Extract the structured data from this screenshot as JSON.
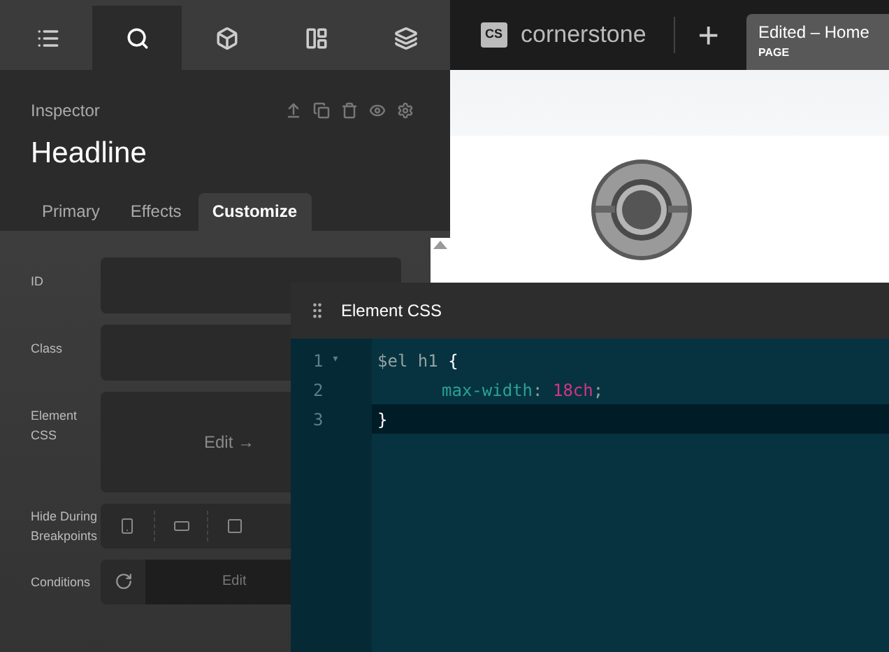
{
  "toolbar": {
    "tabs": [
      {
        "kind": "list",
        "selected": false
      },
      {
        "kind": "search",
        "selected": true
      },
      {
        "kind": "cube",
        "selected": false
      },
      {
        "kind": "layout",
        "selected": false
      },
      {
        "kind": "layers",
        "selected": false
      }
    ]
  },
  "inspector": {
    "label": "Inspector",
    "title": "Headline",
    "actions": [
      {
        "kind": "up"
      },
      {
        "kind": "copy"
      },
      {
        "kind": "trash"
      },
      {
        "kind": "eye"
      },
      {
        "kind": "gear"
      }
    ],
    "tabs": [
      {
        "label": "Primary",
        "selected": false
      },
      {
        "label": "Effects",
        "selected": false
      },
      {
        "label": "Customize",
        "selected": true
      }
    ],
    "fields": [
      {
        "kind": "text",
        "label": "ID"
      },
      {
        "kind": "text",
        "label": "Class"
      },
      {
        "kind": "edit",
        "label": "Element CSS",
        "button": "Edit →"
      },
      {
        "kind": "breakpoints",
        "label": "Hide During Breakpoints",
        "devices": [
          {
            "kind": "phone"
          },
          {
            "kind": "tablet"
          },
          {
            "kind": "square"
          }
        ]
      },
      {
        "kind": "conditions",
        "label": "Conditions",
        "button": "Edit"
      }
    ]
  },
  "topbar": {
    "badge": "CS",
    "brand": "cornerstone",
    "add": "+",
    "doc_title": "Edited – Home",
    "doc_type": "PAGE"
  },
  "css_panel": {
    "title": "Element CSS",
    "lines": [
      {
        "number": "1",
        "fold": "▾",
        "active": false,
        "tokens": [
          {
            "kind": "plain",
            "text": "$el h1 "
          },
          {
            "kind": "brace",
            "text": "{"
          }
        ]
      },
      {
        "number": "2",
        "active": false,
        "indented": true,
        "tokens": [
          {
            "kind": "property",
            "text": "max-width"
          },
          {
            "kind": "plain",
            "text": ": "
          },
          {
            "kind": "value",
            "text": "18ch"
          },
          {
            "kind": "plain",
            "text": ";"
          }
        ]
      },
      {
        "number": "3",
        "active": true,
        "tokens": [
          {
            "kind": "brace",
            "text": "}"
          }
        ]
      }
    ]
  }
}
